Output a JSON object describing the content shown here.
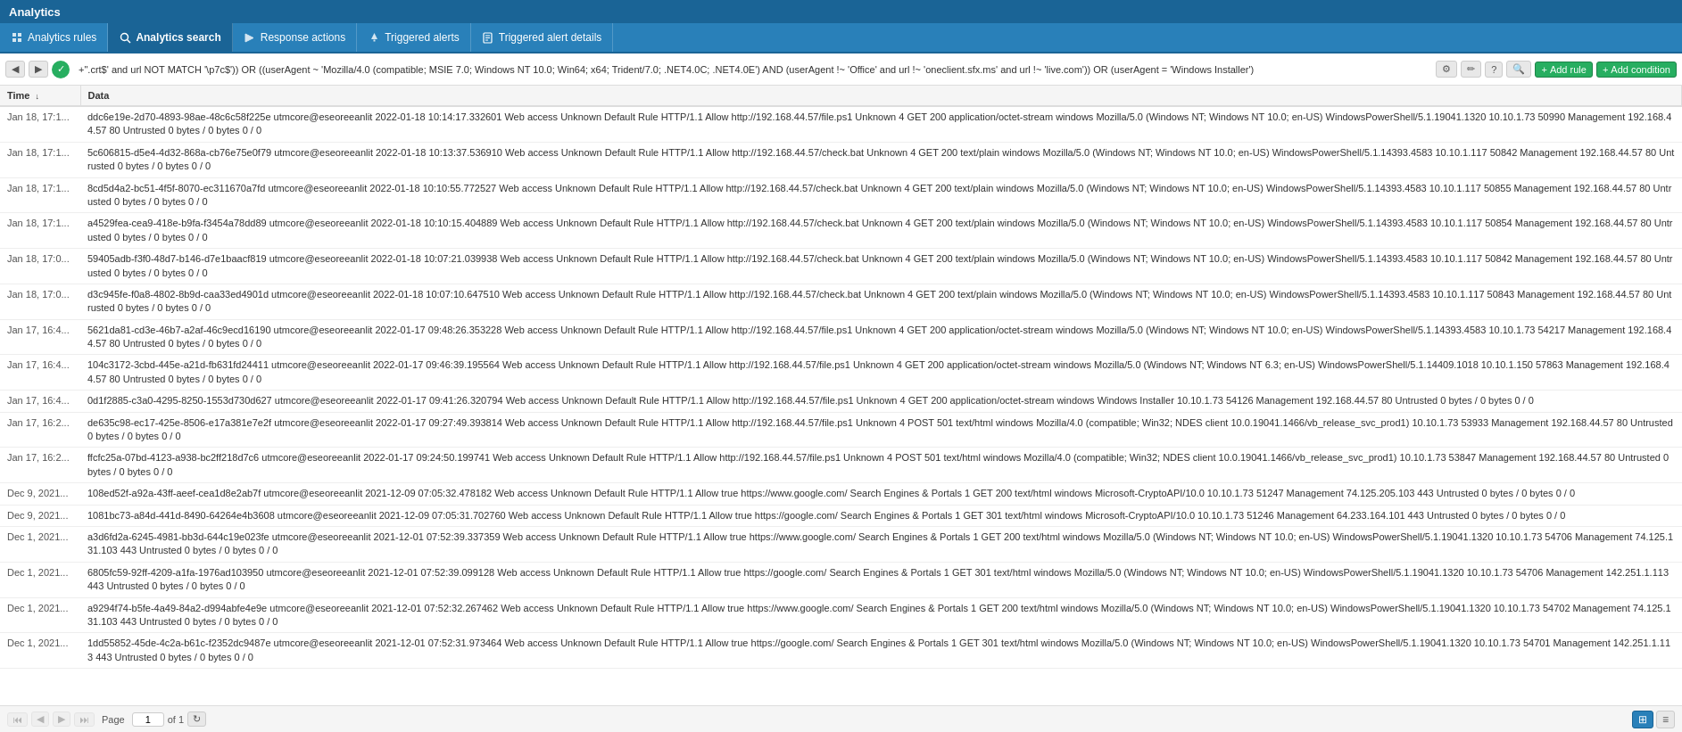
{
  "app": {
    "title": "Analytics"
  },
  "tabs": [
    {
      "id": "analytics-rules",
      "label": "Analytics rules",
      "icon": "chart-icon",
      "active": false
    },
    {
      "id": "analytics-search",
      "label": "Analytics search",
      "icon": "search-icon",
      "active": true
    },
    {
      "id": "response-actions",
      "label": "Response actions",
      "icon": "action-icon",
      "active": false
    },
    {
      "id": "triggered-alerts",
      "label": "Triggered alerts",
      "icon": "alert-icon",
      "active": false
    },
    {
      "id": "triggered-alert-details",
      "label": "Triggered alert details",
      "icon": "detail-icon",
      "active": false
    }
  ],
  "filterbar": {
    "query": "+\".crt$' and url NOT MATCH '\\p7c$')) OR ((userAgent ~ 'Mozilla/4.0 (compatible; MSIE 7.0; Windows NT 10.0; Win64; x64; Trident/7.0; .NET4.0C; .NET4.0E') AND (userAgent !~ 'Office' and url !~ 'oneclient.sfx.ms' and url !~ 'live.com')) OR (userAgent = 'Windows Installer')",
    "add_rule_label": "Add rule",
    "add_condition_label": "Add condition"
  },
  "table": {
    "columns": [
      "Time ↓",
      "Data"
    ],
    "rows": [
      {
        "time": "Jan 18, 17:1...",
        "data": "ddc6e19e-2d70-4893-98ae-48c6c58f225e utmcore@eseoreeanlit 2022-01-18 10:14:17.332601 Web access Unknown Default Rule HTTP/1.1 Allow http://192.168.44.57/file.ps1 Unknown 4 GET 200 application/octet-stream windows Mozilla/5.0 (Windows NT; Windows NT 10.0; en-US) WindowsPowerShell/5.1.19041.1320 10.10.1.73 50990 Management 192.168.44.57 80 Untrusted 0 bytes / 0 bytes 0 / 0"
      },
      {
        "time": "Jan 18, 17:1...",
        "data": "5c606815-d5e4-4d32-868a-cb76e75e0f79 utmcore@eseoreeanlit 2022-01-18 10:13:37.536910 Web access Unknown Default Rule HTTP/1.1 Allow http://192.168.44.57/check.bat Unknown 4 GET 200 text/plain windows Mozilla/5.0 (Windows NT; Windows NT 10.0; en-US) WindowsPowerShell/5.1.14393.4583 10.10.1.117 50842 Management 192.168.44.57 80 Untrusted 0 bytes / 0 bytes 0 / 0"
      },
      {
        "time": "Jan 18, 17:1...",
        "data": "8cd5d4a2-bc51-4f5f-8070-ec311670a7fd utmcore@eseoreeanlit 2022-01-18 10:10:55.772527 Web access Unknown Default Rule HTTP/1.1 Allow http://192.168.44.57/check.bat Unknown 4 GET 200 text/plain windows Mozilla/5.0 (Windows NT; Windows NT 10.0; en-US) WindowsPowerShell/5.1.14393.4583 10.10.1.117 50855 Management 192.168.44.57 80 Untrusted 0 bytes / 0 bytes 0 / 0"
      },
      {
        "time": "Jan 18, 17:1...",
        "data": "a4529fea-cea9-418e-b9fa-f3454a78dd89 utmcore@eseoreeanlit 2022-01-18 10:10:15.404889 Web access Unknown Default Rule HTTP/1.1 Allow http://192.168.44.57/check.bat Unknown 4 GET 200 text/plain windows Mozilla/5.0 (Windows NT; Windows NT 10.0; en-US) WindowsPowerShell/5.1.14393.4583 10.10.1.117 50854 Management 192.168.44.57 80 Untrusted 0 bytes / 0 bytes 0 / 0"
      },
      {
        "time": "Jan 18, 17:0...",
        "data": "59405adb-f3f0-48d7-b146-d7e1baacf819 utmcore@eseoreeanlit 2022-01-18 10:07:21.039938 Web access Unknown Default Rule HTTP/1.1 Allow http://192.168.44.57/check.bat Unknown 4 GET 200 text/plain windows Mozilla/5.0 (Windows NT; Windows NT 10.0; en-US) WindowsPowerShell/5.1.14393.4583 10.10.1.117 50842 Management 192.168.44.57 80 Untrusted 0 bytes / 0 bytes 0 / 0"
      },
      {
        "time": "Jan 18, 17:0...",
        "data": "d3c945fe-f0a8-4802-8b9d-caa33ed4901d utmcore@eseoreeanlit 2022-01-18 10:07:10.647510 Web access Unknown Default Rule HTTP/1.1 Allow http://192.168.44.57/check.bat Unknown 4 GET 200 text/plain windows Mozilla/5.0 (Windows NT; Windows NT 10.0; en-US) WindowsPowerShell/5.1.14393.4583 10.10.1.117 50843 Management 192.168.44.57 80 Untrusted 0 bytes / 0 bytes 0 / 0"
      },
      {
        "time": "Jan 17, 16:4...",
        "data": "5621da81-cd3e-46b7-a2af-46c9ecd16190 utmcore@eseoreeanlit 2022-01-17 09:48:26.353228 Web access Unknown Default Rule HTTP/1.1 Allow http://192.168.44.57/file.ps1 Unknown 4 GET 200 application/octet-stream windows Mozilla/5.0 (Windows NT; Windows NT 10.0; en-US) WindowsPowerShell/5.1.14393.4583 10.10.1.73 54217 Management 192.168.44.57 80 Untrusted 0 bytes / 0 bytes 0 / 0"
      },
      {
        "time": "Jan 17, 16:4...",
        "data": "104c3172-3cbd-445e-a21d-fb631fd24411 utmcore@eseoreeanlit 2022-01-17 09:46:39.195564 Web access Unknown Default Rule HTTP/1.1 Allow http://192.168.44.57/file.ps1 Unknown 4 GET 200 application/octet-stream windows Mozilla/5.0 (Windows NT; Windows NT 6.3; en-US) WindowsPowerShell/5.1.14409.1018 10.10.1.150 57863 Management 192.168.44.57 80 Untrusted 0 bytes / 0 bytes 0 / 0"
      },
      {
        "time": "Jan 17, 16:4...",
        "data": "0d1f2885-c3a0-4295-8250-1553d730d627 utmcore@eseoreeanlit 2022-01-17 09:41:26.320794 Web access Unknown Default Rule HTTP/1.1 Allow http://192.168.44.57/file.ps1 Unknown 4 GET 200 application/octet-stream windows Windows Installer 10.10.1.73 54126 Management 192.168.44.57 80 Untrusted 0 bytes / 0 bytes 0 / 0"
      },
      {
        "time": "Jan 17, 16:2...",
        "data": "de635c98-ec17-425e-8506-e17a381e7e2f utmcore@eseoreeanlit 2022-01-17 09:27:49.393814 Web access Unknown Default Rule HTTP/1.1 Allow http://192.168.44.57/file.ps1 Unknown 4 POST 501 text/html windows Mozilla/4.0 (compatible; Win32; NDES client 10.0.19041.1466/vb_release_svc_prod1) 10.10.1.73 53933 Management 192.168.44.57 80 Untrusted 0 bytes / 0 bytes 0 / 0"
      },
      {
        "time": "Jan 17, 16:2...",
        "data": "ffcfc25a-07bd-4123-a938-bc2ff218d7c6 utmcore@eseoreeanlit 2022-01-17 09:24:50.199741 Web access Unknown Default Rule HTTP/1.1 Allow http://192.168.44.57/file.ps1 Unknown 4 POST 501 text/html windows Mozilla/4.0 (compatible; Win32; NDES client 10.0.19041.1466/vb_release_svc_prod1) 10.10.1.73 53847 Management 192.168.44.57 80 Untrusted 0 bytes / 0 bytes 0 / 0"
      },
      {
        "time": "Dec 9, 2021...",
        "data": "108ed52f-a92a-43ff-aeef-cea1d8e2ab7f utmcore@eseoreeanlit 2021-12-09 07:05:32.478182 Web access Unknown Default Rule HTTP/1.1 Allow true https://www.google.com/ Search Engines & Portals 1 GET 200 text/html windows Microsoft-CryptoAPI/10.0 10.10.1.73 51247 Management 74.125.205.103 443 Untrusted 0 bytes / 0 bytes 0 / 0"
      },
      {
        "time": "Dec 9, 2021...",
        "data": "1081bc73-a84d-441d-8490-64264e4b3608 utmcore@eseoreeanlit 2021-12-09 07:05:31.702760 Web access Unknown Default Rule HTTP/1.1 Allow true https://google.com/ Search Engines & Portals 1 GET 301 text/html windows Microsoft-CryptoAPI/10.0 10.10.1.73 51246 Management 64.233.164.101 443 Untrusted 0 bytes / 0 bytes 0 / 0"
      },
      {
        "time": "Dec 1, 2021...",
        "data": "a3d6fd2a-6245-4981-bb3d-644c19e023fe utmcore@eseoreeanlit 2021-12-01 07:52:39.337359 Web access Unknown Default Rule HTTP/1.1 Allow true https://www.google.com/ Search Engines & Portals 1 GET 200 text/html windows Mozilla/5.0 (Windows NT; Windows NT 10.0; en-US) WindowsPowerShell/5.1.19041.1320 10.10.1.73 54706 Management 74.125.131.103 443 Untrusted 0 bytes / 0 bytes 0 / 0"
      },
      {
        "time": "Dec 1, 2021...",
        "data": "6805fc59-92ff-4209-a1fa-1976ad103950 utmcore@eseoreeanlit 2021-12-01 07:52:39.099128 Web access Unknown Default Rule HTTP/1.1 Allow true https://google.com/ Search Engines & Portals 1 GET 301 text/html windows Mozilla/5.0 (Windows NT; Windows NT 10.0; en-US) WindowsPowerShell/5.1.19041.1320 10.10.1.73 54706 Management 142.251.1.113 443 Untrusted 0 bytes / 0 bytes 0 / 0"
      },
      {
        "time": "Dec 1, 2021...",
        "data": "a9294f74-b5fe-4a49-84a2-d994abfe4e9e utmcore@eseoreeanlit 2021-12-01 07:52:32.267462 Web access Unknown Default Rule HTTP/1.1 Allow true https://www.google.com/ Search Engines & Portals 1 GET 200 text/html windows Mozilla/5.0 (Windows NT; Windows NT 10.0; en-US) WindowsPowerShell/5.1.19041.1320 10.10.1.73 54702 Management 74.125.131.103 443 Untrusted 0 bytes / 0 bytes 0 / 0"
      },
      {
        "time": "Dec 1, 2021...",
        "data": "1dd55852-45de-4c2a-b61c-f2352dc9487e utmcore@eseoreeanlit 2021-12-01 07:52:31.973464 Web access Unknown Default Rule HTTP/1.1 Allow true https://google.com/ Search Engines & Portals 1 GET 301 text/html windows Mozilla/5.0 (Windows NT; Windows NT 10.0; en-US) WindowsPowerShell/5.1.19041.1320 10.10.1.73 54701 Management 142.251.1.113 443 Untrusted 0 bytes / 0 bytes 0 / 0"
      }
    ]
  },
  "pagination": {
    "page_label": "Page",
    "current_page": "1",
    "of_label": "of 1"
  },
  "icons": {
    "prev_first": "⏮",
    "prev": "◀",
    "next": "▶",
    "next_last": "⏭",
    "refresh": "↻",
    "grid": "⊞",
    "list": "≡",
    "search": "🔍",
    "edit": "✏",
    "delete": "🗑",
    "add": "+",
    "check": "✓"
  }
}
